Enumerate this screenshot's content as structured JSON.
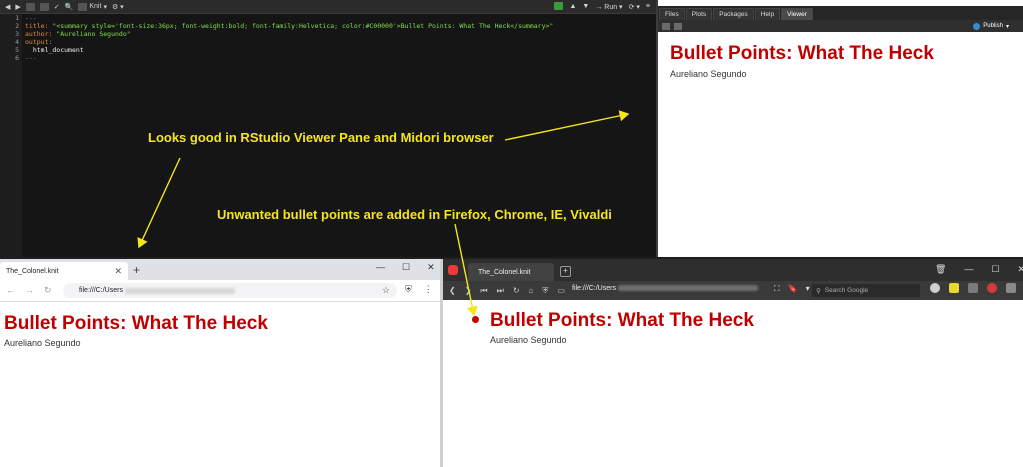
{
  "editor": {
    "toolbar": {
      "knit_label": "Knit",
      "run_label": "Run"
    },
    "line_numbers": [
      "1",
      "2",
      "3",
      "4",
      "5",
      "6"
    ],
    "lines": {
      "l1": "---",
      "l2_key": "title: ",
      "l2_val": "\"<summary style='font-size:36px; font-weight:bold; font-family:Helvetica; color:#C00000'>Bullet Points: What The Heck</summary>\"",
      "l3_key": "author: ",
      "l3_val": "\"Aureliano Segundo\"",
      "l4_key": "output:",
      "l5": "  html_document",
      "l6": "---"
    }
  },
  "viewer": {
    "tabs": [
      "Files",
      "Plots",
      "Packages",
      "Help",
      "Viewer"
    ],
    "publish_label": "Publish",
    "title": "Bullet Points: What The Heck",
    "author": "Aureliano Segundo"
  },
  "browser_chrome": {
    "tab_title": "The_Colonel.knit",
    "url_prefix": "file:///C:/Users",
    "title": "Bullet Points: What The Heck",
    "author": "Aureliano Segundo"
  },
  "browser_vivaldi": {
    "tab_title": "The_Colonel.knit",
    "url_prefix": "file:///C:/Users",
    "search_placeholder": "Search Google",
    "title": "Bullet Points: What The Heck",
    "author": "Aureliano Segundo"
  },
  "annotations": {
    "good": "Looks good in RStudio Viewer Pane and Midori browser",
    "bad": "Unwanted bullet points are added in Firefox, Chrome, IE, Vivaldi"
  },
  "colors": {
    "heading_red": "#c00000",
    "annotation_yellow": "#f5e61c",
    "code_green": "#7ee04a",
    "code_orange": "#e08a3a"
  }
}
